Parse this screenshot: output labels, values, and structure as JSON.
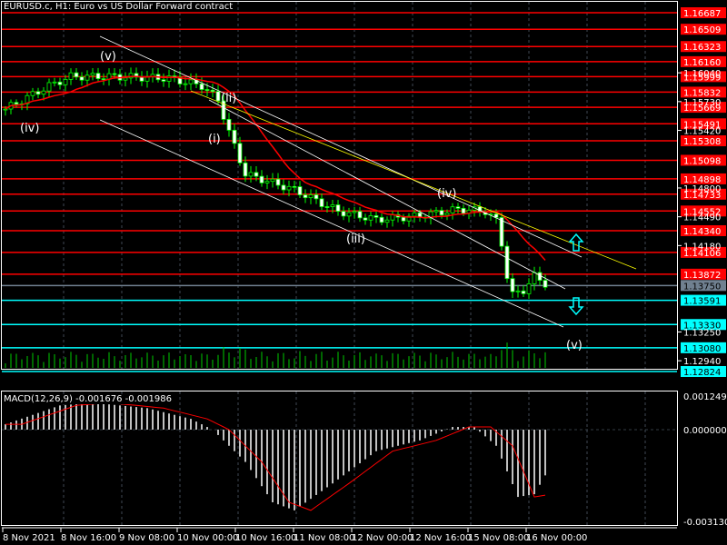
{
  "header": {
    "title": "EURUSD.c, H1:  Euro vs US Dollar Forward contract",
    "macd_title": "MACD(12,26,9) -0.001676 -0.001986"
  },
  "colors": {
    "background": "#000000",
    "resistance": "#ff0000",
    "support": "#00ffff",
    "candle": "#00ff00",
    "ma": "#ff0000",
    "trend": "#ffff00",
    "channel": "#ffffff",
    "current_price": "#708090"
  },
  "price_axis": {
    "min": 1.12824,
    "max": 1.16687,
    "ticks": [
      "1.16040",
      "1.15730",
      "1.15420",
      "1.14800",
      "1.14490",
      "1.14180",
      "1.13250",
      "1.12940"
    ]
  },
  "levels": {
    "resistance": [
      "1.16687",
      "1.16509",
      "1.16323",
      "1.16160",
      "1.15999",
      "1.15832",
      "1.15669",
      "1.15491",
      "1.15308",
      "1.15098",
      "1.14898",
      "1.14733",
      "1.14552",
      "1.14340",
      "1.14106",
      "1.13872"
    ],
    "current": "1.13750",
    "support": [
      "1.13591",
      "1.13330",
      "1.13080",
      "1.12824"
    ]
  },
  "time_axis": [
    "8 Nov 2021",
    "8 Nov 16:00",
    "9 Nov 08:00",
    "10 Nov 00:00",
    "10 Nov 16:00",
    "11 Nov 08:00",
    "12 Nov 00:00",
    "12 Nov 16:00",
    "15 Nov 08:00",
    "16 Nov 00:00"
  ],
  "waves": [
    "(iv)",
    "(v)",
    "(i)",
    "(ii)",
    "(iii)",
    "(iv)",
    "(v)"
  ],
  "macd_axis": {
    "top": "0.001249",
    "zero": "0.000000",
    "bottom": "-0.003130",
    "min": -0.00313,
    "max": 0.001249
  },
  "chart_data": {
    "type": "candlestick",
    "bars": 100,
    "price_keypoints": [
      [
        0,
        1.1565
      ],
      [
        8,
        1.159
      ],
      [
        12,
        1.16
      ],
      [
        20,
        1.16
      ],
      [
        30,
        1.1598
      ],
      [
        36,
        1.159
      ],
      [
        39,
        1.1575
      ],
      [
        41,
        1.154
      ],
      [
        44,
        1.1495
      ],
      [
        53,
        1.1478
      ],
      [
        61,
        1.1455
      ],
      [
        68,
        1.1446
      ],
      [
        76,
        1.145
      ],
      [
        83,
        1.1457
      ],
      [
        88,
        1.1455
      ],
      [
        90,
        1.1445
      ],
      [
        91,
        1.142
      ],
      [
        92,
        1.1385
      ],
      [
        93,
        1.1365
      ],
      [
        95,
        1.137
      ],
      [
        97,
        1.1385
      ],
      [
        99,
        1.1377
      ]
    ],
    "macd_keypoints": [
      [
        0,
        0.0002
      ],
      [
        10,
        0.0009
      ],
      [
        16,
        0.001
      ],
      [
        26,
        0.0008
      ],
      [
        34,
        0.0004
      ],
      [
        38,
        0.0
      ],
      [
        44,
        -0.0012
      ],
      [
        49,
        -0.0027
      ],
      [
        53,
        -0.003
      ],
      [
        60,
        -0.002
      ],
      [
        68,
        -0.0008
      ],
      [
        76,
        -0.0004
      ],
      [
        82,
        0.0001
      ],
      [
        86,
        0.0001
      ],
      [
        90,
        -0.0006
      ],
      [
        94,
        -0.0025
      ],
      [
        97,
        -0.0024
      ],
      [
        99,
        -0.0017
      ]
    ]
  }
}
